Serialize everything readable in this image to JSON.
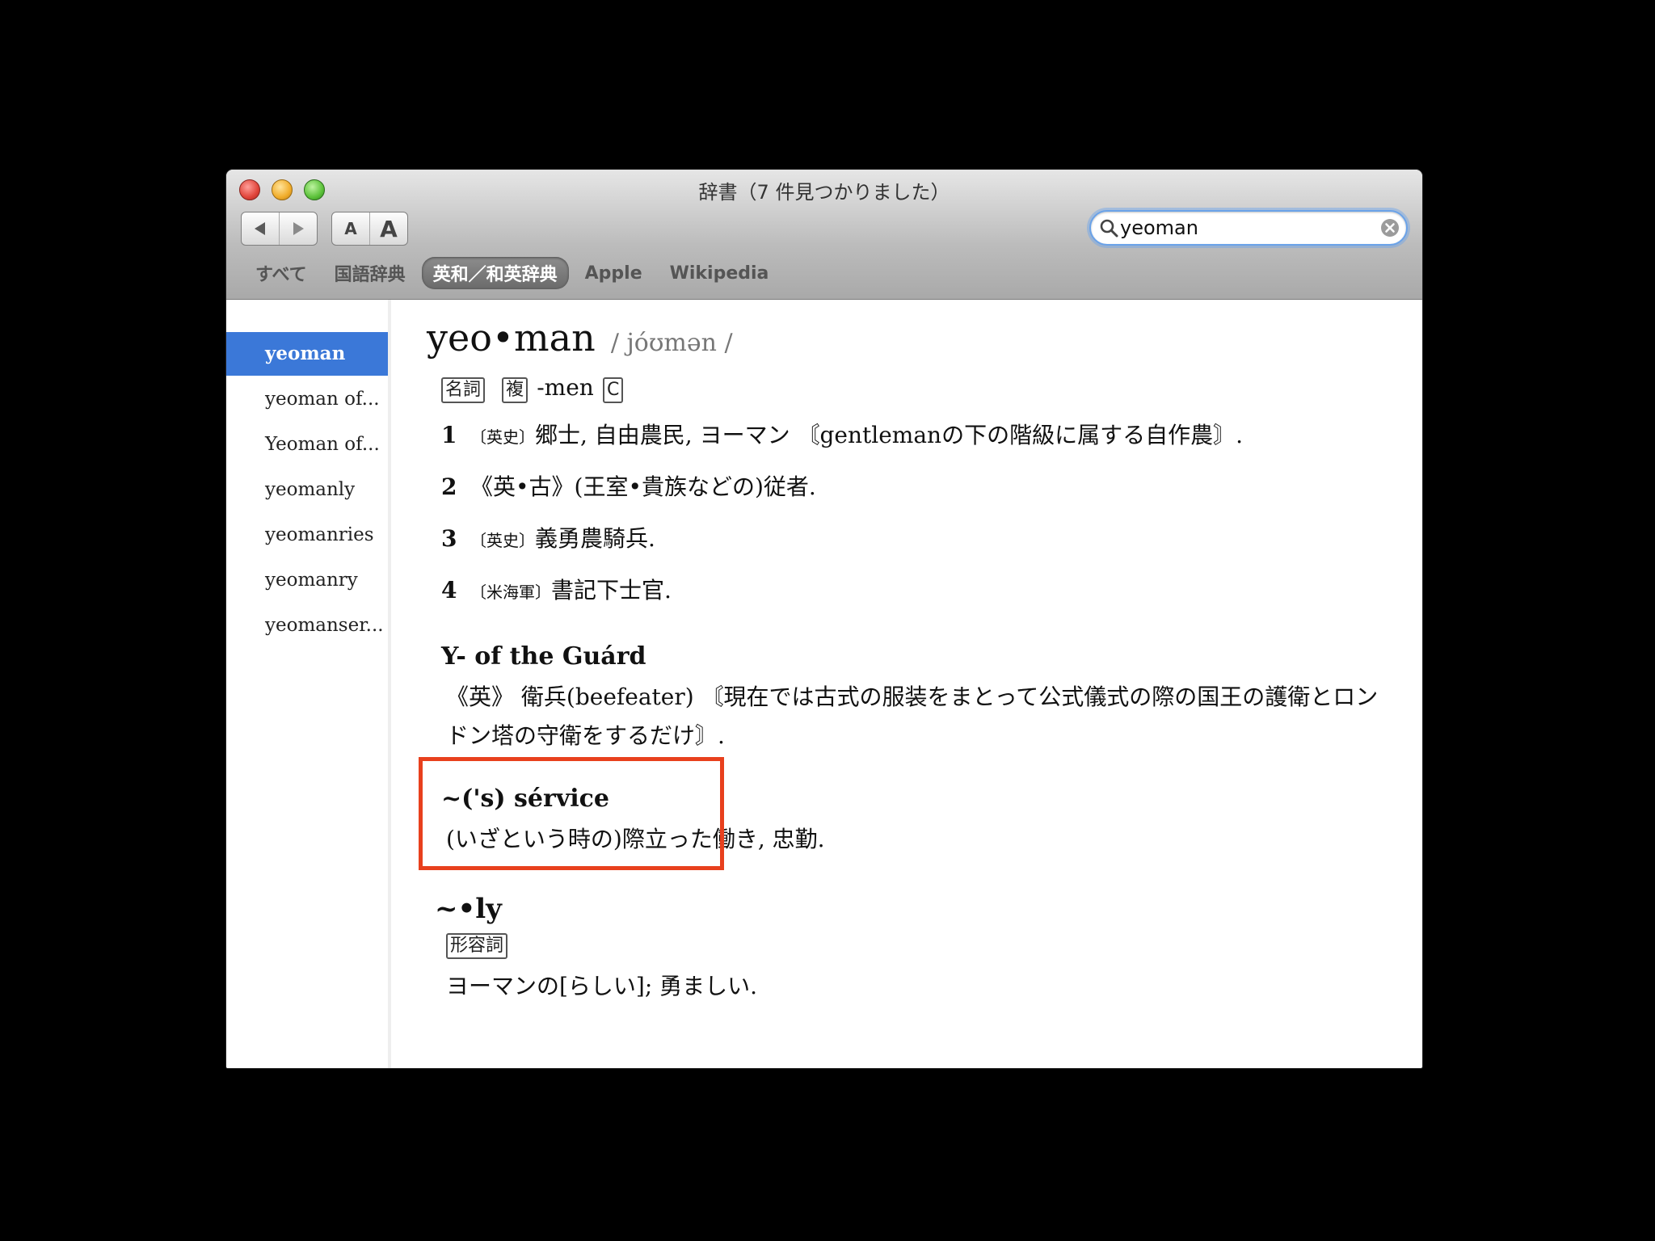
{
  "window": {
    "title": "辞書（7 件見つかりました）"
  },
  "toolbar": {
    "back_icon": "triangle-left-icon",
    "forward_icon": "triangle-right-icon",
    "font_smaller_label": "A",
    "font_larger_label": "A"
  },
  "search": {
    "value": "yeoman"
  },
  "tabs": [
    {
      "label": "すべて"
    },
    {
      "label": "国語辞典"
    },
    {
      "label": "英和／和英辞典",
      "active": true
    },
    {
      "label": "Apple"
    },
    {
      "label": "Wikipedia"
    }
  ],
  "sidebar": {
    "items": [
      {
        "label": "yeoman",
        "selected": true
      },
      {
        "label": "yeoman of..."
      },
      {
        "label": "Yeoman of..."
      },
      {
        "label": "yeomanly"
      },
      {
        "label": "yeomanries"
      },
      {
        "label": "yeomanry"
      },
      {
        "label": "yeomanser..."
      }
    ]
  },
  "entry": {
    "headword": "yeo•man",
    "pronunciation": "/ jóʊmən /",
    "pos_tag": "名詞",
    "plural_tag": "複",
    "plural_form": "-men",
    "countable_tag": "C",
    "senses": [
      {
        "num": "1",
        "label": "〔英史〕",
        "text": "郷士, 自由農民, ヨーマン 〘gentlemanの下の階級に属する自作農〙."
      },
      {
        "num": "2",
        "label": "",
        "text": "《英•古》(王室•貴族などの)従者."
      },
      {
        "num": "3",
        "label": "〔英史〕",
        "text": "義勇農騎兵."
      },
      {
        "num": "4",
        "label": "〔米海軍〕",
        "text": "書記下士官."
      }
    ],
    "phrases": [
      {
        "title": "Y- of the Guárd",
        "text": "《英》 衛兵(beefeater) 〘現在では古式の服装をまとって公式儀式の際の国王の護衛とロンドン塔の守衛をするだけ〙."
      },
      {
        "title": "~('s) sérvice",
        "text": "(いざという時の)際立った働き, 忠勤."
      }
    ],
    "derived": {
      "title": "~•ly",
      "tag": "形容詞",
      "text": "ヨーマンの[らしい]; 勇ましい."
    }
  },
  "colors": {
    "selection": "#3b78d8",
    "highlight_box": "#e8401d"
  }
}
